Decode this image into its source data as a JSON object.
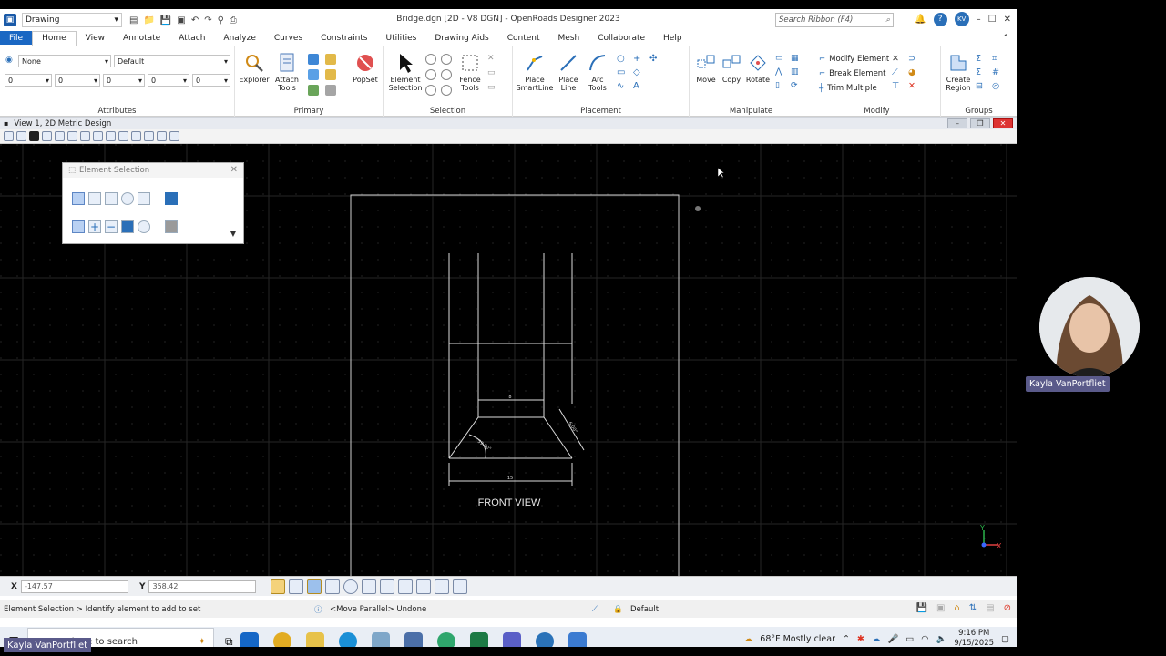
{
  "titlebar": {
    "workspace": "Drawing",
    "title": "Bridge.dgn [2D - V8 DGN] - OpenRoads Designer 2023",
    "search_placeholder": "Search Ribbon (F4)",
    "user_initials": "KV"
  },
  "tabs": [
    "File",
    "Home",
    "View",
    "Annotate",
    "Attach",
    "Analyze",
    "Curves",
    "Constraints",
    "Utilities",
    "Drawing Aids",
    "Content",
    "Mesh",
    "Collaborate",
    "Help"
  ],
  "ribbon": {
    "attributes": {
      "level": "None",
      "style": "Default",
      "color": "0",
      "weight": "0",
      "linestyle": "0",
      "transparency": "0",
      "priority": "0",
      "label": "Attributes"
    },
    "primary": {
      "explorer": "Explorer",
      "attach_tools": "Attach Tools",
      "popset": "PopSet",
      "label": "Primary"
    },
    "selection": {
      "element_selection": "Element Selection",
      "fence_tools": "Fence Tools",
      "label": "Selection"
    },
    "placement": {
      "smartline": "Place SmartLine",
      "line": "Place Line",
      "arc_tools": "Arc Tools",
      "label": "Placement"
    },
    "manipulate": {
      "move": "Move",
      "copy": "Copy",
      "rotate": "Rotate",
      "label": "Manipulate"
    },
    "modify": {
      "modify_element": "Modify Element",
      "break_element": "Break Element",
      "trim_multiple": "Trim Multiple",
      "label": "Modify"
    },
    "groups": {
      "create_region": "Create Region",
      "label": "Groups"
    }
  },
  "view": {
    "title": "View 1, 2D Metric Design"
  },
  "dialog": {
    "title": "Element Selection"
  },
  "drawing": {
    "label": "FRONT VIEW",
    "dim_top": "8",
    "dim_bottom": "15",
    "dim_side": "6.00\"",
    "dim_angle": "59.00°"
  },
  "coords": {
    "x_label": "X",
    "x_value": "-147.57",
    "y_label": "Y",
    "y_value": "358.42"
  },
  "status": {
    "prompt": "Element Selection > Identify element to add to set",
    "message": "<Move Parallel> Undone",
    "level": "Default"
  },
  "taskbar": {
    "search_placeholder": "Type here to search",
    "weather": "68°F  Mostly clear",
    "time": "9:16 PM",
    "date": "9/15/2025"
  },
  "presenter": {
    "name": "Kayla VanPortfliet"
  },
  "colors": {
    "accent": "#1a67c3",
    "canvas": "#000000",
    "lines": "#dcdcdc"
  }
}
